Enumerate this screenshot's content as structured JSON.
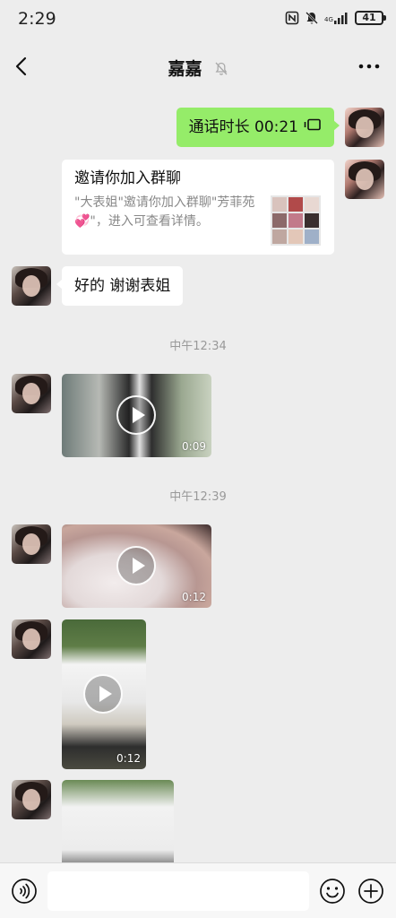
{
  "status_bar": {
    "time": "2:29",
    "battery": "41"
  },
  "header": {
    "title": "嘉嘉"
  },
  "messages": {
    "call": {
      "text": "通话时长 00:21"
    },
    "invite": {
      "title": "邀请你加入群聊",
      "description": "\"大表姐\"邀请你加入群聊\"芳菲苑💞\"，进入可查看详情。"
    },
    "reply": {
      "text": "好的 谢谢表姐"
    },
    "timestamp_1": "中午12:34",
    "video_1": {
      "duration": "0:09"
    },
    "timestamp_2": "中午12:39",
    "video_2": {
      "duration": "0:12"
    },
    "video_3": {
      "duration": "0:12"
    }
  },
  "input": {
    "placeholder": ""
  },
  "colors": {
    "sent_bubble": "#95ec69",
    "background": "#ededed"
  },
  "icons": [
    "back-arrow-icon",
    "mute-bell-icon",
    "more-dots-icon",
    "call-phone-icon",
    "play-icon",
    "voice-icon",
    "emoji-icon",
    "plus-icon"
  ]
}
